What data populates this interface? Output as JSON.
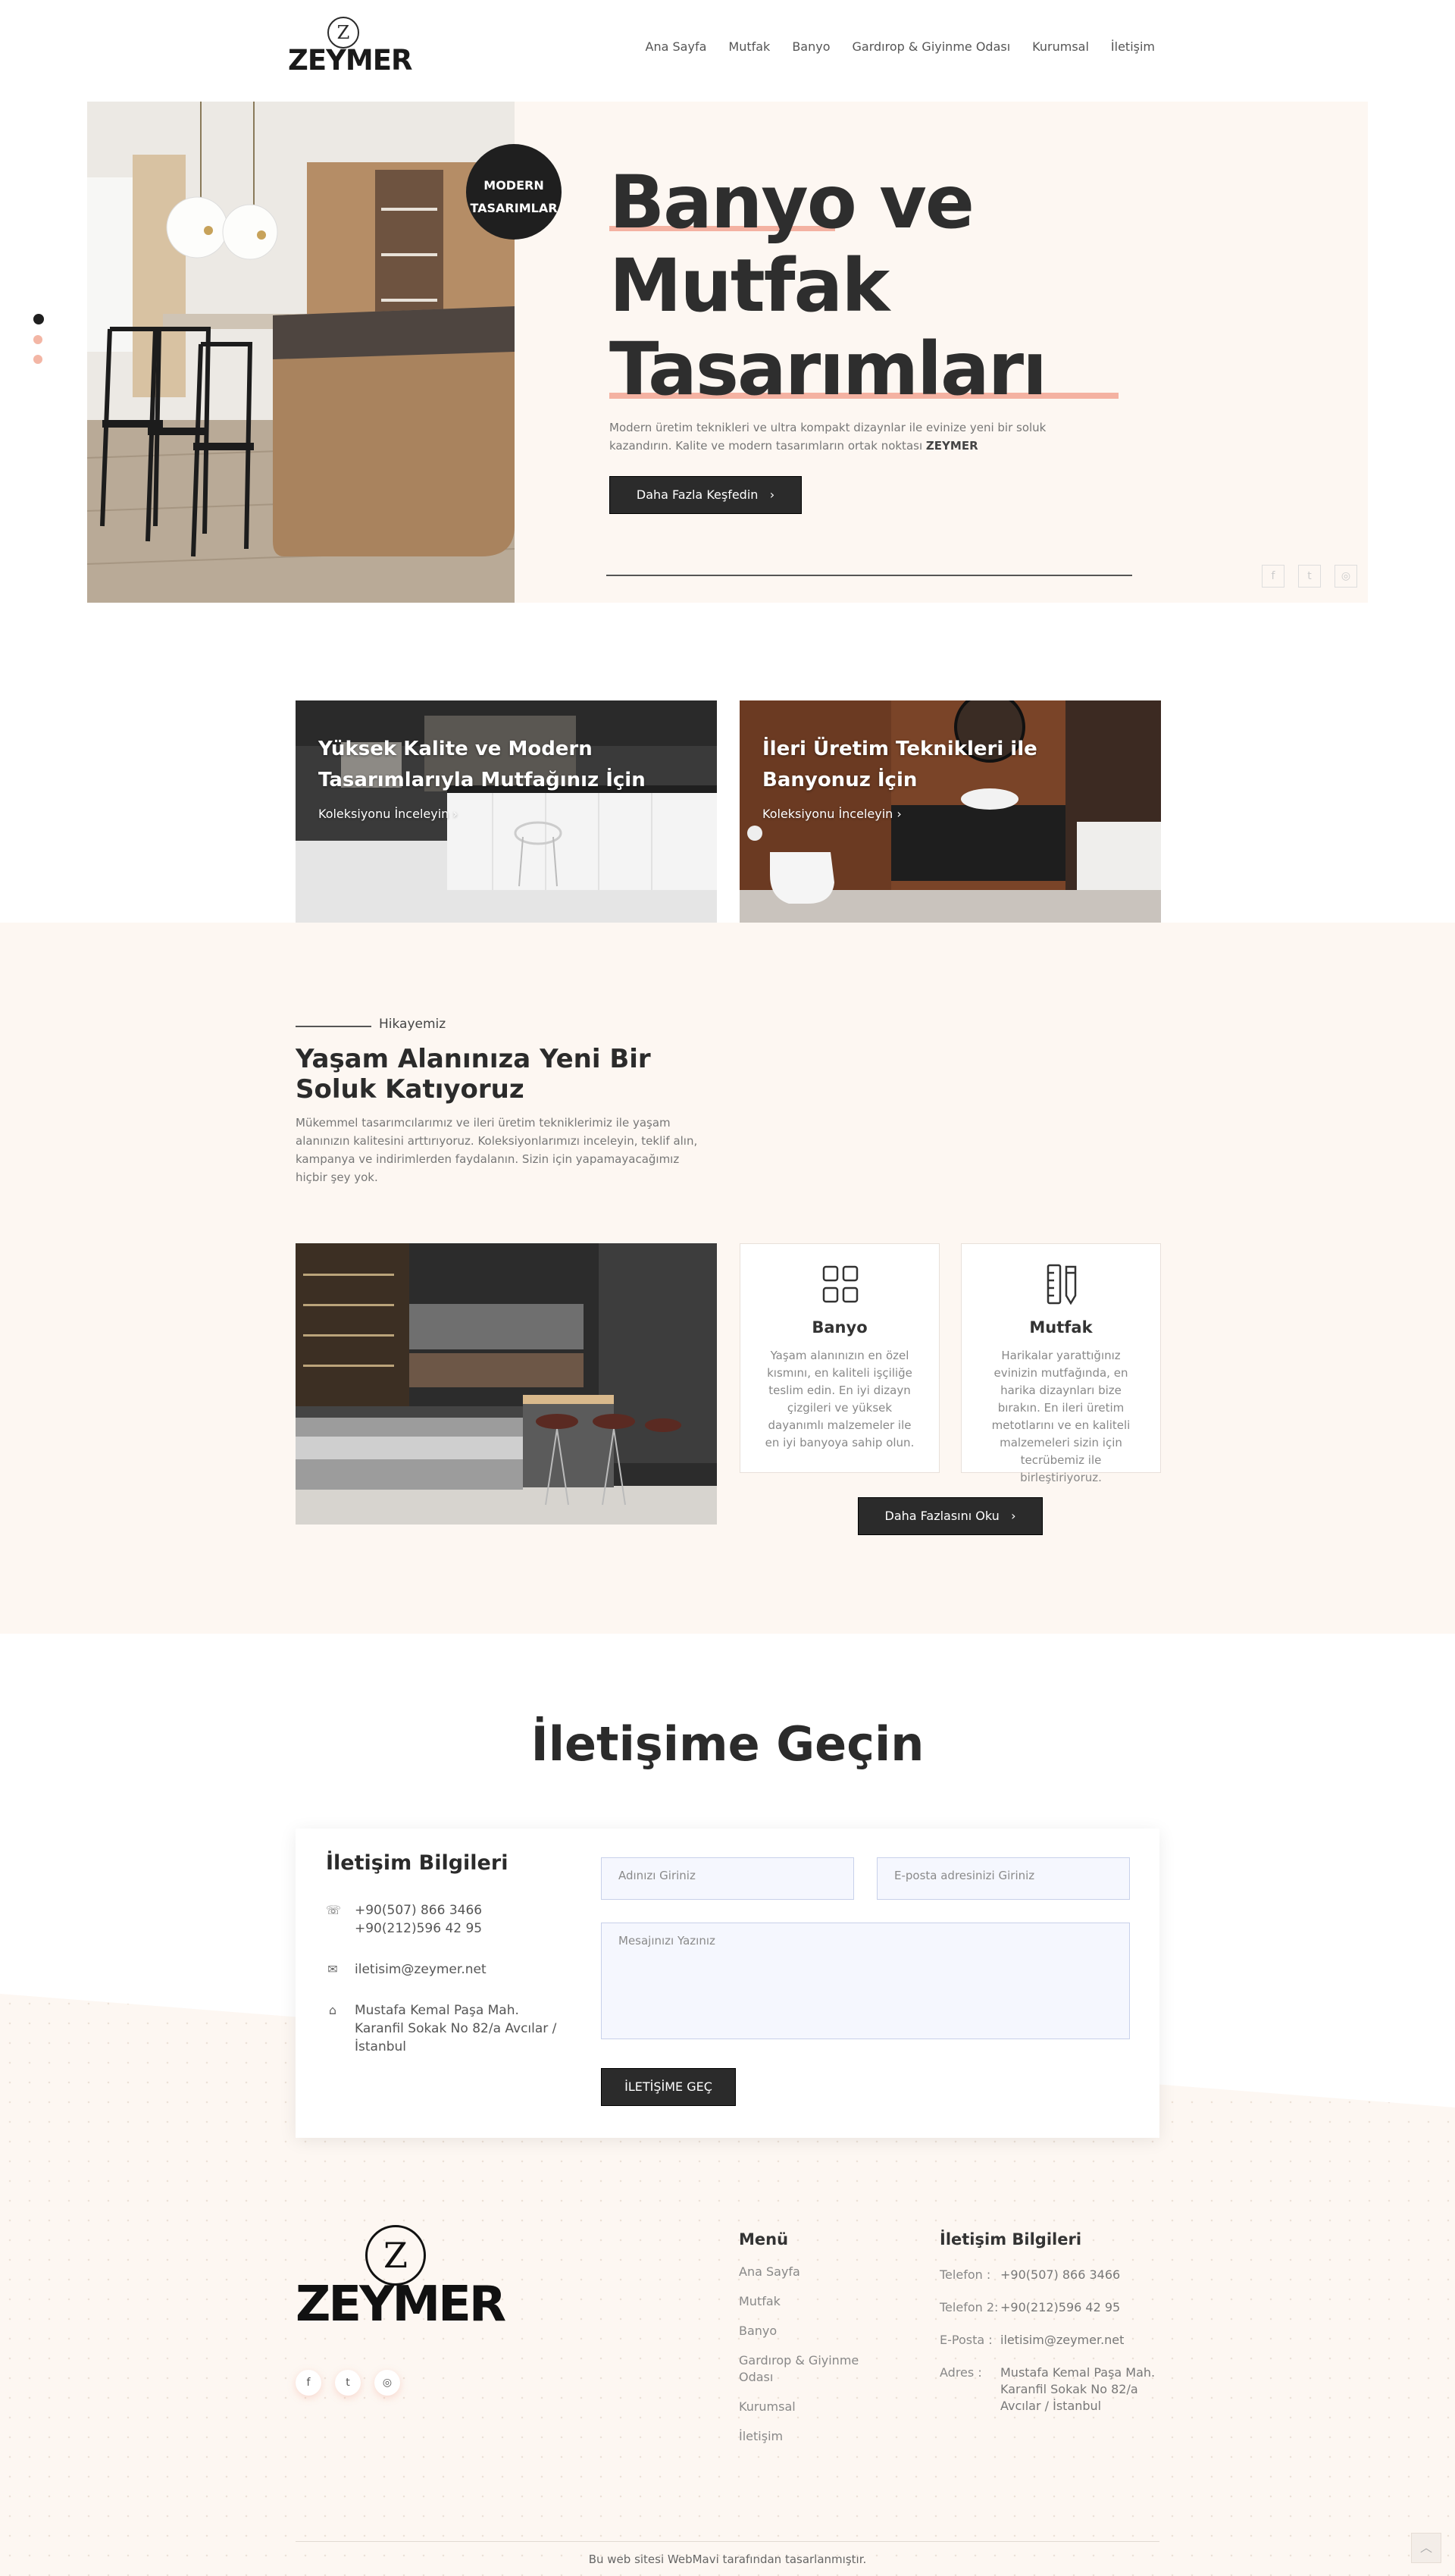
{
  "brand": {
    "name": "ZEYMER",
    "monogram": "Z"
  },
  "nav": [
    {
      "label": "Ana Sayfa"
    },
    {
      "label": "Mutfak"
    },
    {
      "label": "Banyo"
    },
    {
      "label": "Gardırop & Giyinme Odası"
    },
    {
      "label": "Kurumsal"
    },
    {
      "label": "İletişim"
    }
  ],
  "hero": {
    "badge_line1": "MODERN",
    "badge_line2": "TASARIMLAR",
    "title_line1": "Banyo ve",
    "title_line2": "Mutfak",
    "title_line3": "Tasarımları",
    "description": "Modern üretim teknikleri ve ultra kompakt dizaynlar ile evinize yeni bir soluk kazandırın. Kalite ve modern tasarımların ortak noktası",
    "description_brand": "ZEYMER",
    "button_label": "Daha Fazla Keşfedin",
    "slides_total": 3,
    "slide_active": 1,
    "social_icons": [
      "facebook-icon",
      "twitter-icon",
      "instagram-icon"
    ]
  },
  "promos": [
    {
      "title": "Yüksek Kalite ve Modern Tasarımlarıyla Mutfağınız İçin",
      "link": "Koleksiyonu İnceleyin"
    },
    {
      "title": "İleri Üretim Teknikleri ile Banyonuz İçin",
      "link": "Koleksiyonu İnceleyin"
    }
  ],
  "story": {
    "eyebrow": "Hikayemiz",
    "title": "Yaşam Alanınıza Yeni Bir Soluk Katıyoruz",
    "text": "Mükemmel tasarımcılarımız ve ileri üretim tekniklerimiz ile yaşam alanınızın kalitesini arttırıyoruz. Koleksiyonlarımızı inceleyin, teklif alın, kampanya ve indirimlerden faydalanın. Sizin için yapamayacağımız hiçbir şey yok.",
    "features": [
      {
        "icon": "grid-icon",
        "title": "Banyo",
        "text": "Yaşam alanınızın en özel kısmını, en kaliteli işçiliğe teslim edin. En iyi dizayn çizgileri ve yüksek dayanımlı malzemeler ile en iyi banyoya sahip olun."
      },
      {
        "icon": "ruler-pencil-icon",
        "title": "Mutfak",
        "text": "Harikalar yarattığınız evinizin mutfağında, en harika dizaynları bize bırakın. En ileri üretim metotlarını ve en kaliteli malzemeleri sizin için tecrübemiz ile birleştiriyoruz."
      }
    ],
    "button_label": "Daha Fazlasını Oku"
  },
  "contact": {
    "section_title": "İletişime Geçin",
    "info_title": "İletişim Bilgileri",
    "phone1": "+90(507) 866 3466",
    "phone2": "+90(212)596 42 95",
    "email": "iletisim@zeymer.net",
    "address_line1": "Mustafa Kemal Paşa Mah.",
    "address_line2": "Karanfil Sokak No 82/a Avcılar /",
    "address_line3": "İstanbul",
    "name_placeholder": "Adınızı Giriniz",
    "email_placeholder": "E-posta adresinizi Giriniz",
    "message_placeholder": "Mesajınızı Yazınız",
    "submit_label": "İLETİŞİME GEÇ"
  },
  "footer": {
    "menu_title": "Menü",
    "menu": [
      "Ana Sayfa",
      "Mutfak",
      "Banyo",
      "Gardırop & Giyinme Odası",
      "Kurumsal",
      "İletişim"
    ],
    "contact_title": "İletişim Bilgileri",
    "contact_rows": [
      {
        "label": "Telefon :",
        "value": "+90(507) 866 3466"
      },
      {
        "label": "Telefon 2:",
        "value": "+90(212)596 42 95"
      },
      {
        "label": "E-Posta :",
        "value": "iletisim@zeymer.net"
      },
      {
        "label": "Adres :",
        "value": "Mustafa Kemal Paşa Mah. Karanfil Sokak No 82/a Avcılar / İstanbul"
      }
    ],
    "social_icons": [
      "facebook-icon",
      "twitter-icon",
      "instagram-icon"
    ],
    "copyright": "Bu web sitesi WebMavi tarafından tasarlanmıştır."
  },
  "colors": {
    "accent": "#f4b2a2",
    "cream": "#fdf7f2",
    "dark": "#2b2b2b"
  }
}
